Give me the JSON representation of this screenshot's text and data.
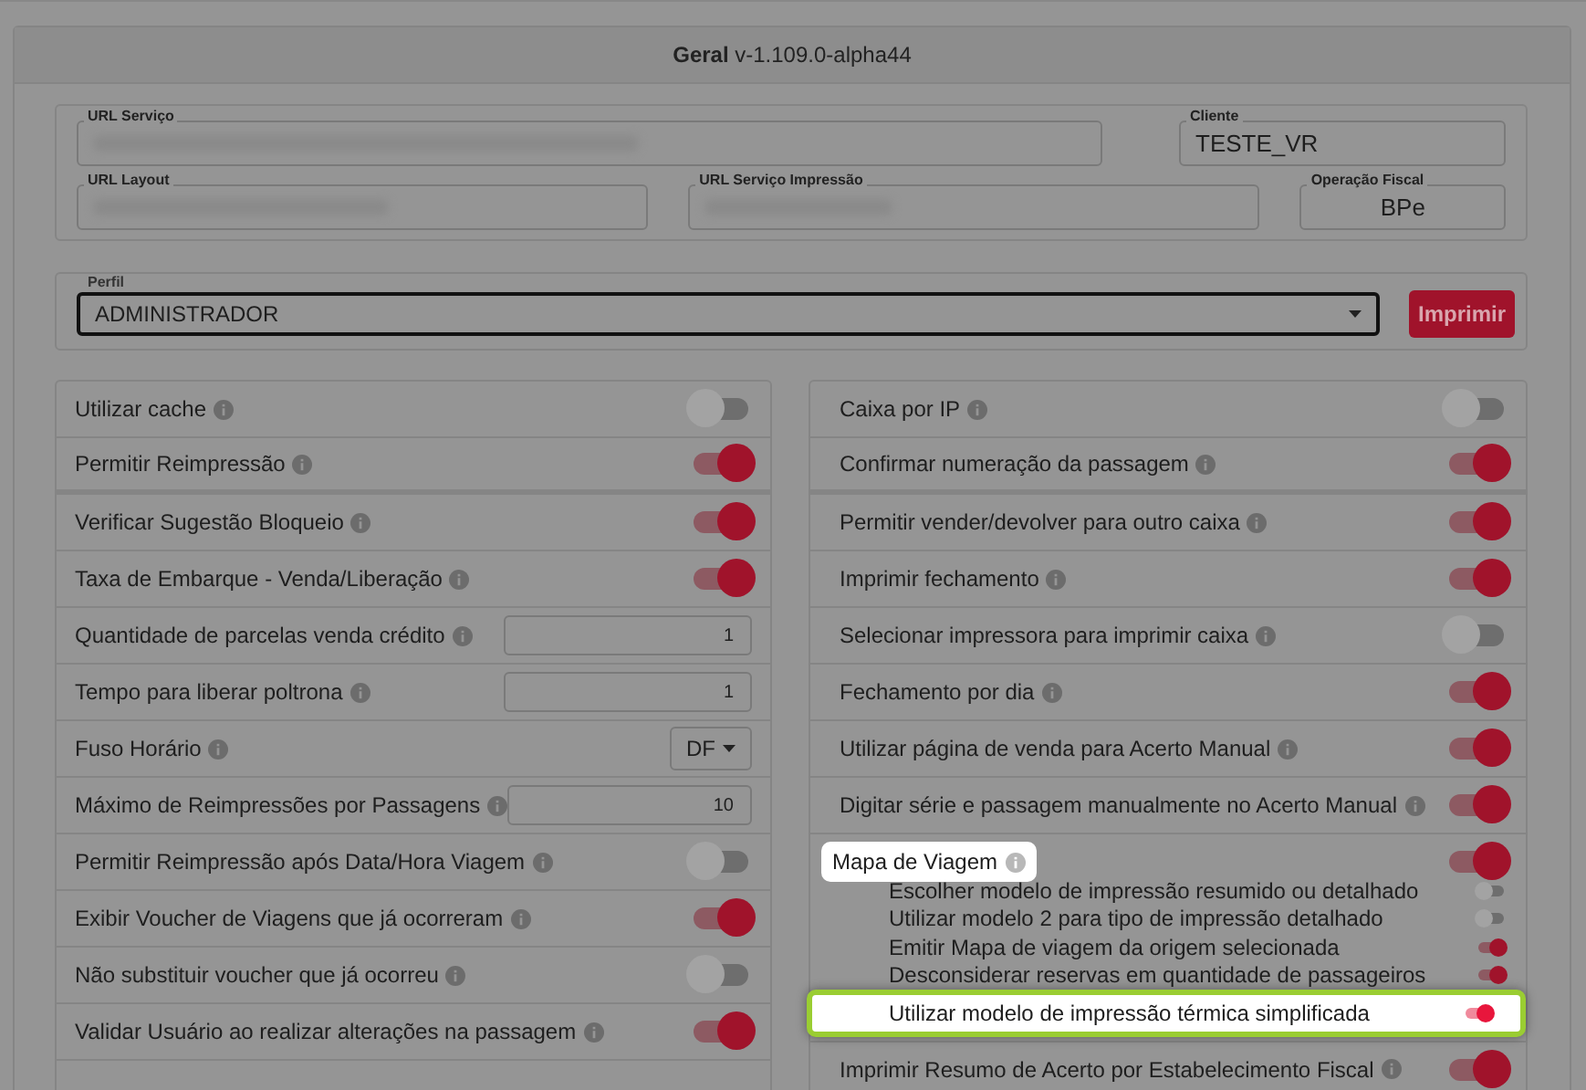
{
  "panel": {
    "title": "Geral",
    "version": "v-1.109.0-alpha44"
  },
  "fields_row_1": [
    {
      "label": "URL Serviço"
    },
    {
      "label": "Cliente",
      "value": "TESTE_VR"
    }
  ],
  "fields_row_2": [
    {
      "label": "URL Layout"
    },
    {
      "label": "URL Serviço Impressão"
    },
    {
      "label": "Operação Fiscal",
      "value": "BPe"
    }
  ],
  "profile": {
    "label": "Perfil",
    "value": "ADMINISTRADOR",
    "button": "Imprimir"
  },
  "left_settings": [
    {
      "label": "Utilizar cache",
      "kind": "toggle",
      "on": false
    },
    {
      "label": "Permitir Reimpressão",
      "kind": "toggle",
      "on": true
    },
    {
      "label": "Verificar Sugestão Bloqueio",
      "kind": "toggle",
      "on": true
    },
    {
      "label": "Taxa de Embarque - Venda/Liberação",
      "kind": "toggle",
      "on": true
    },
    {
      "label": "Quantidade de parcelas venda crédito",
      "kind": "number",
      "value": "1"
    },
    {
      "label": "Tempo para liberar poltrona",
      "kind": "number",
      "value": "1"
    },
    {
      "label": "Fuso Horário",
      "kind": "select",
      "value": "DF"
    },
    {
      "label": "Máximo de Reimpressões por Passagens",
      "kind": "number",
      "value": "10"
    },
    {
      "label": "Permitir Reimpressão após Data/Hora Viagem",
      "kind": "toggle",
      "on": false
    },
    {
      "label": "Exibir Voucher de Viagens que já ocorreram",
      "kind": "toggle",
      "on": true
    },
    {
      "label": "Não substituir voucher que já ocorreu",
      "kind": "toggle",
      "on": false
    },
    {
      "label": "Validar Usuário ao realizar alterações na passagem",
      "kind": "toggle",
      "on": true
    }
  ],
  "right_settings": [
    {
      "label": "Caixa por IP",
      "on": false,
      "highlighted": false
    },
    {
      "label": "Confirmar numeração da passagem",
      "on": true,
      "highlighted": false
    },
    {
      "label": "Permitir vender/devolver para outro caixa",
      "on": true,
      "highlighted": false
    },
    {
      "label": "Imprimir fechamento",
      "on": true,
      "highlighted": false
    },
    {
      "label": "Selecionar impressora para imprimir caixa",
      "on": false,
      "highlighted": false
    },
    {
      "label": "Fechamento por dia",
      "on": true,
      "highlighted": false
    },
    {
      "label": "Utilizar página de venda para Acerto Manual",
      "on": true,
      "highlighted": false
    },
    {
      "label": "Digitar série e passagem manualmente no Acerto Manual",
      "on": true,
      "highlighted": false
    },
    {
      "label": "Mapa de Viagem",
      "on": true,
      "highlighted": true,
      "children": [
        {
          "label": "Escolher modelo de impressão resumido ou detalhado",
          "on": false,
          "highlighted": false
        },
        {
          "label": "Utilizar modelo 2 para tipo de impressão detalhado",
          "on": false,
          "highlighted": false
        },
        {
          "label": "Emitir Mapa de viagem da origem selecionada",
          "on": true,
          "highlighted": false
        },
        {
          "label": "Desconsiderar reservas em quantidade de passageiros",
          "on": true,
          "highlighted": false
        },
        {
          "label": "Utilizar modelo de impressão térmica simplificada",
          "on": true,
          "highlighted": true
        }
      ]
    },
    {
      "label": "Imprimir Resumo de Acerto por Estabelecimento Fiscal",
      "on": true,
      "highlighted": false
    }
  ]
}
